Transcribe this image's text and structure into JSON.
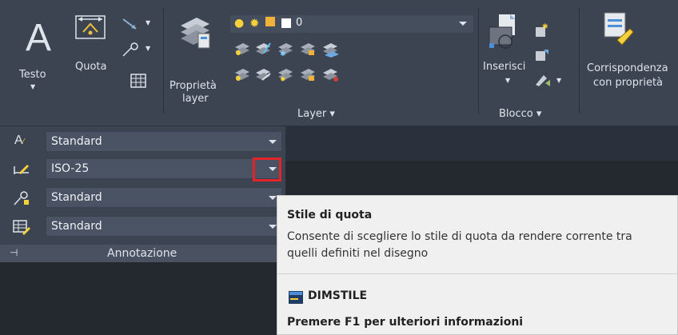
{
  "ribbon": {
    "text_label": "Testo",
    "dim_label": "Quota",
    "layer_props_label_1": "Proprietà",
    "layer_props_label_2": "layer",
    "layer_combo_value": "0",
    "layer_panel_title": "Layer ▾",
    "insert_label": "Inserisci",
    "block_panel_title": "Blocco ▾",
    "match_props_label_1": "Corrispondenza",
    "match_props_label_2": "con proprietà"
  },
  "annotation": {
    "text_style": "Standard",
    "dim_style": "ISO-25",
    "multileader_style": "Standard",
    "table_style": "Standard",
    "panel_title": "Annotazione"
  },
  "tooltip": {
    "title": "Stile di quota",
    "description_1": "Consente di scegliere lo stile di quota da rendere corrente tra",
    "description_2": "quelli definiti nel disegno",
    "command": "DIMSTILE",
    "help": "Premere F1 per ulteriori informazioni"
  },
  "colors": {
    "ribbon_bg": "#3c4452",
    "highlight": "#e0242a",
    "tooltip_bg": "#f0f0f0"
  }
}
